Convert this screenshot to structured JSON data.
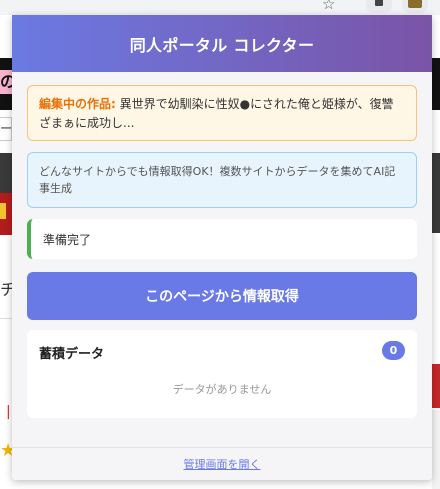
{
  "background": {
    "left_fragment_pink": "の",
    "left_fragment_text": "ー",
    "left_fragment_chi": "チ"
  },
  "popup": {
    "title": "同人ポータル コレクター",
    "editing": {
      "label": "編集中の作品:",
      "title": "異世界で幼馴染に性奴●にされた俺と姫様が、復讐ざまぁに成功し..."
    },
    "info_text": "どんなサイトからでも情報取得OK！複数サイトからデータを集めてAI記事生成",
    "status_text": "準備完了",
    "fetch_button_label": "このページから情報取得",
    "stored_data": {
      "title": "蓄積データ",
      "count": "0",
      "empty_text": "データがありません"
    },
    "footer_link": "管理画面を開く"
  },
  "colors": {
    "header_gradient_start": "#6b7ae3",
    "header_gradient_end": "#7a54a6",
    "accent": "#6979e6",
    "editing_label": "#e8710a",
    "status_ok": "#4caf50"
  },
  "icons": [
    "bookmark-star-icon",
    "extension-icon",
    "extension-app-icon"
  ]
}
